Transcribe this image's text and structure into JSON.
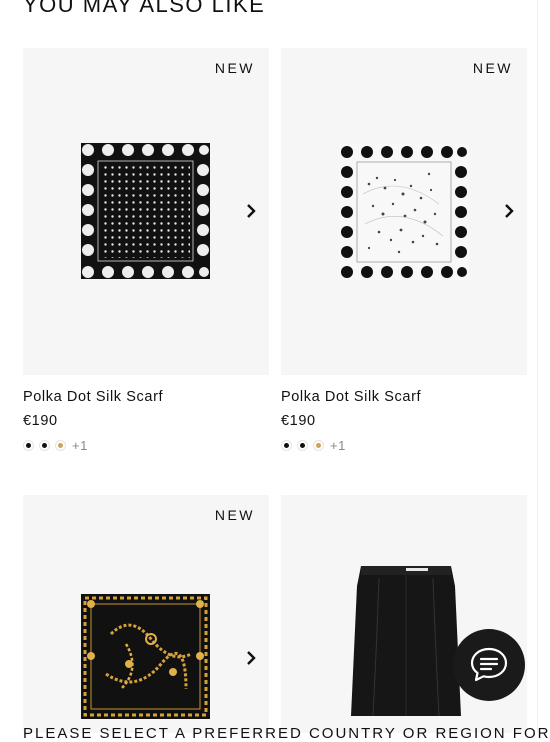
{
  "section": {
    "title": "YOU MAY ALSO LIKE"
  },
  "products": [
    {
      "badge": "NEW",
      "name": "Polka Dot Silk Scarf",
      "price": "€190",
      "swatches": [
        "#111111",
        "#111111",
        "#c9a45c"
      ],
      "more": "+1",
      "image_icon": "polka-dot-scarf-black"
    },
    {
      "badge": "NEW",
      "name": "Polka Dot Silk Scarf",
      "price": "€190",
      "swatches": [
        "#111111",
        "#111111",
        "#c9a45c"
      ],
      "more": "+1",
      "image_icon": "polka-dot-scarf-white"
    },
    {
      "badge": "NEW",
      "image_icon": "chain-print-scarf"
    },
    {
      "image_icon": "black-pencil-skirt"
    }
  ],
  "chat": {
    "icon": "chat-bubble-icon"
  },
  "banner": {
    "text": "PLEASE SELECT A PREFERRED COUNTRY OR REGION FOR A"
  },
  "colors": {
    "card_bg": "#f6f6f6",
    "chat_bg": "#1a1a1a",
    "gold": "#c9a45c"
  }
}
